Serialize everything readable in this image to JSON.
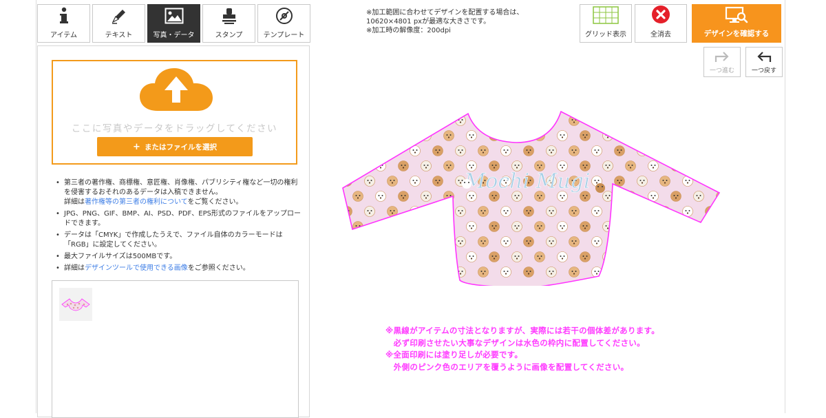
{
  "tabs": [
    {
      "label": "アイテム",
      "icon": "info-icon",
      "active": false
    },
    {
      "label": "テキスト",
      "icon": "pen-icon",
      "active": false
    },
    {
      "label": "写真・データ",
      "icon": "image-icon",
      "active": true
    },
    {
      "label": "スタンプ",
      "icon": "stamp-icon",
      "active": false
    },
    {
      "label": "テンプレート",
      "icon": "template-icon",
      "active": false
    }
  ],
  "upload": {
    "drop_hint": "ここに写真やデータをドラッグしてください",
    "file_button": "またはファイルを選択",
    "upload_icon": "cloud-upload-icon"
  },
  "notes": [
    {
      "text": "第三者の著作権、商標権、意匠権、肖像権、パブリシティ権など一切の権利を侵害するおそれのあるデータは入稿できません。"
    },
    {
      "pre": "詳細は",
      "link": "著作権等の第三者の権利について",
      "post": "をご覧ください。"
    },
    {
      "text": "JPG、PNG、GIF、BMP、AI、PSD、PDF、EPS形式のファイルをアップロードできます。"
    },
    {
      "text": "データは「CMYK」で作成したうえで、ファイル自体のカラーモードは「RGB」に設定してください。"
    },
    {
      "text": "最大ファイルサイズは500MBです。"
    },
    {
      "pre": "詳細は",
      "link": "デザインツールで使用できる画像",
      "post": "をご参照ください。"
    }
  ],
  "info": {
    "line1": "※加工範囲に合わせてデザインを配置する場合は、",
    "line2": "10620×4801 pxが最適な大きさです。",
    "line3": "※加工時の解像度：200dpi"
  },
  "toolbar": {
    "grid_label": "グリッド表示",
    "clear_label": "全消去",
    "confirm_label": "デザインを確認する",
    "redo_label": "一つ進む",
    "undo_label": "一つ戻す"
  },
  "design": {
    "logo_text": "Mochi Mugi",
    "fabric_color": "#f3dcea",
    "outline_color": "#ff33ff",
    "logo_color": "#a9cfe6"
  },
  "caution": {
    "line1": "※黒線がアイテムの寸法となりますが、実際には若干の個体差があります。",
    "line2": "　必ず印刷させたい大事なデザインは水色の枠内に配置してください。",
    "line3": "※全面印刷には塗り足しが必要です。",
    "line4": "　外側のピンク色のエリアを覆うように画像を配置してください。"
  },
  "colors": {
    "accent": "#f39a1a",
    "confirm": "#f7941d",
    "link": "#3e7ee6",
    "caution": "#ff3cff",
    "clear_red": "#e5202a",
    "grid_green": "#8cc63f"
  }
}
